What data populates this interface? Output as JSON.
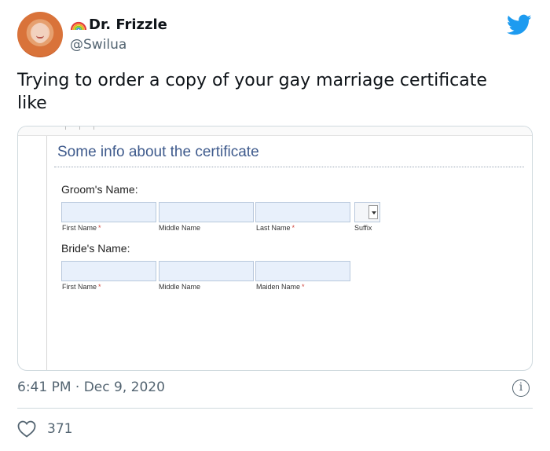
{
  "tweet": {
    "author": {
      "display_name": "Dr. Frizzle",
      "handle": "@Swilua",
      "name_emoji": "rainbow-icon"
    },
    "text": "Trying to order a copy of your gay marriage certificate like",
    "timestamp": "6:41 PM · Dec 9, 2020",
    "likes": "371",
    "brand_color": "#1d9bf0"
  },
  "form": {
    "title": "Some info about the certificate",
    "groom_label": "Groom's Name:",
    "groom_fields": [
      {
        "label": "First Name",
        "required": "*"
      },
      {
        "label": "Middle Name",
        "required": ""
      },
      {
        "label": "Last Name",
        "required": "*"
      }
    ],
    "suffix_label": "Suffix",
    "bride_label": "Bride's Name:",
    "bride_fields": [
      {
        "label": "First Name",
        "required": "*"
      },
      {
        "label": "Middle Name",
        "required": ""
      },
      {
        "label": "Maiden Name",
        "required": "*"
      }
    ],
    "colors": {
      "title": "#3e5a8c",
      "field_fill": "#e8f0fb",
      "required": "#d0443b"
    }
  }
}
